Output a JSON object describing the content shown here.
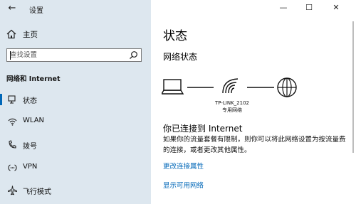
{
  "window": {
    "title": "设置",
    "back_icon": "←",
    "minimize_icon": "—",
    "maximize_icon": "☐",
    "close_icon": "✕"
  },
  "sidebar": {
    "home_label": "主页",
    "search": {
      "placeholder": "查找设置"
    },
    "section_header": "网络和 Internet",
    "items": [
      {
        "label": "状态",
        "icon": "status-icon",
        "active": true
      },
      {
        "label": "WLAN",
        "icon": "wifi-icon",
        "active": false
      },
      {
        "label": "拨号",
        "icon": "dialup-icon",
        "active": false
      },
      {
        "label": "VPN",
        "icon": "vpn-icon",
        "active": false
      },
      {
        "label": "飞行模式",
        "icon": "airplane-icon",
        "active": false
      }
    ]
  },
  "main": {
    "title": "状态",
    "network_status_heading": "网络状态",
    "diagram": {
      "network_name": "TP-LINK_2102",
      "network_type": "专用网络"
    },
    "connection_title": "你已连接到 Internet",
    "connection_desc": "如果你的流量套餐有限制，则你可以将此网络设置为按流量费的连接，或者更改其他属性。",
    "links": [
      {
        "label": "更改连接属性"
      },
      {
        "label": "显示可用网络"
      }
    ]
  },
  "colors": {
    "sidebar_bg": "#dde7ef",
    "accent": "#0067b8"
  }
}
